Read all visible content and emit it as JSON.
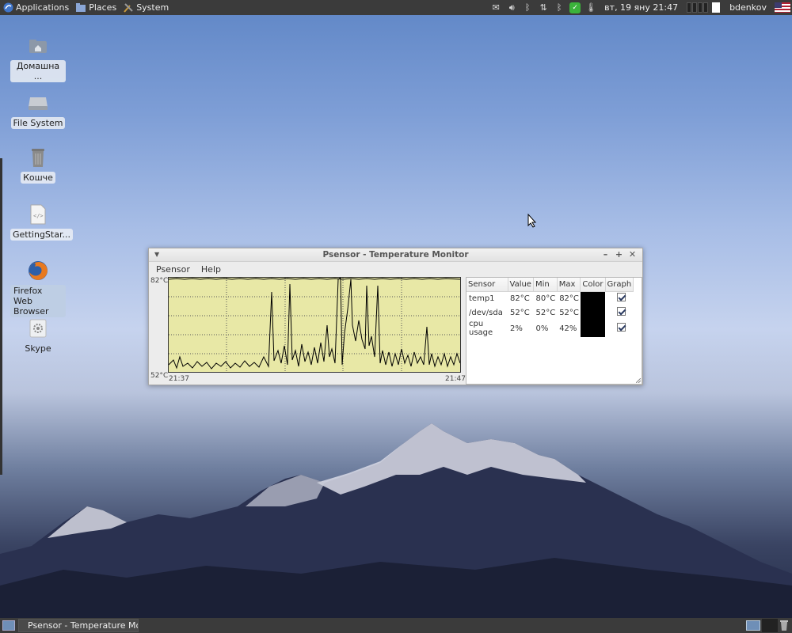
{
  "top_panel": {
    "menus": [
      "Applications",
      "Places",
      "System"
    ],
    "datetime": "вт, 19 яну  21:47",
    "user": "bdenkov",
    "tray_icons": [
      "mail-icon",
      "volume-icon",
      "bluetooth-icon",
      "network-icon",
      "bluetooth-icon",
      "shield-check-icon",
      "thermometer-icon",
      "workspace-switcher",
      "us-flag-icon"
    ]
  },
  "desktop": {
    "icons": [
      {
        "label": "Домашна ...",
        "icon": "home-folder-icon"
      },
      {
        "label": "File System",
        "icon": "drive-icon"
      },
      {
        "label": "Кошче",
        "icon": "trash-icon"
      },
      {
        "label": "GettingStar...",
        "icon": "html-file-icon"
      },
      {
        "label_line1": "Firefox Web",
        "label_line2": "Browser",
        "icon": "firefox-icon"
      },
      {
        "label": "Skype",
        "icon": "gear-file-icon"
      }
    ]
  },
  "window": {
    "title": "Psensor - Temperature Monitor",
    "menu": [
      "Psensor",
      "Help"
    ],
    "graph": {
      "y_top": "82°C",
      "y_bottom": "52°C",
      "x_start": "21:37",
      "x_end": "21:47"
    },
    "table": {
      "headers": [
        "Sensor",
        "Value",
        "Min",
        "Max",
        "Color",
        "Graph"
      ],
      "rows": [
        {
          "sensor": "temp1",
          "value": "82°C",
          "min": "80°C",
          "max": "82°C",
          "color": "#000000",
          "graph": true
        },
        {
          "sensor": "/dev/sda",
          "value": "52°C",
          "min": "52°C",
          "max": "52°C",
          "color": "#000000",
          "graph": true
        },
        {
          "sensor": "cpu usage",
          "value": "2%",
          "min": "0%",
          "max": "42%",
          "color": "#000000",
          "graph": true
        }
      ]
    }
  },
  "taskbar": {
    "task_label": "Psensor - Temperature Mo..."
  },
  "colors": {
    "panel": "#3b3b3b",
    "graph_bg": "#e8e8a6"
  }
}
